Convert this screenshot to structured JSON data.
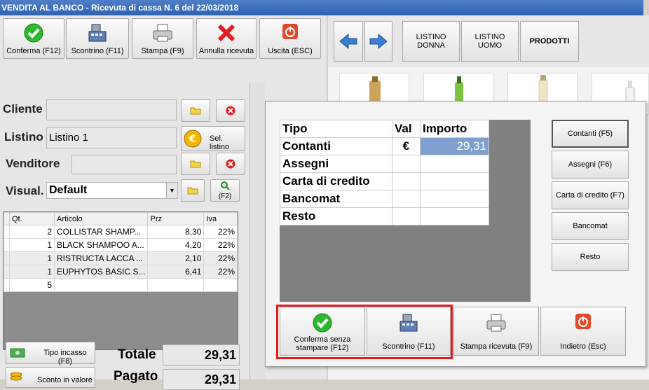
{
  "window": {
    "title": "VENDITA AL BANCO - Ricevuta di cassa N. 6 del 22/03/2018"
  },
  "toolbar": {
    "confirm": "Conferma (F12)",
    "receipt": "Scontrino (F11)",
    "print": "Stampa (F9)",
    "cancel": "Annulla ricevuta",
    "exit": "Uscita (ESC)"
  },
  "nav": {
    "listino_donna": "LISTINO DONNA",
    "listino_uomo": "LISTINO UOMO",
    "prodotti": "PRODOTTI"
  },
  "form": {
    "cliente_label": "Cliente",
    "cliente_value": "",
    "listino_label": "Listino",
    "listino_value": "Listino 1",
    "sel_listino": "Sel. listino",
    "venditore_label": "Venditore",
    "venditore_value": "",
    "visual_label": "Visual.",
    "visual_value": "Default",
    "f2": "(F2)"
  },
  "grid": {
    "headers": {
      "qt": "Qt.",
      "articolo": "Articolo",
      "prz": "Prz",
      "iva": "Iva"
    },
    "rows": [
      {
        "qt": "2",
        "articolo": "COLLISTAR SHAMP...",
        "prz": "8,30",
        "iva": "22%"
      },
      {
        "qt": "1",
        "articolo": "BLACK SHAMPOO A...",
        "prz": "4,20",
        "iva": "22%"
      },
      {
        "qt": "1",
        "articolo": "RISTRUCTA LACCA ...",
        "prz": "2,10",
        "iva": "22%"
      },
      {
        "qt": "1",
        "articolo": "EUPHYTOS BASIC S...",
        "prz": "6,41",
        "iva": "22%"
      },
      {
        "qt": "5",
        "articolo": "",
        "prz": "",
        "iva": ""
      }
    ]
  },
  "bottom": {
    "tipo_incasso": "Tipo incasso (F8)",
    "sconto": "Sconto in valore",
    "totale_label": "Totale",
    "totale_value": "29,31",
    "pagato_label": "Pagato",
    "pagato_value": "29,31"
  },
  "payment": {
    "headers": {
      "tipo": "Tipo",
      "val": "Val",
      "importo": "Importo"
    },
    "rows": [
      {
        "tipo": "Contanti",
        "val": "€",
        "importo": "29,31"
      },
      {
        "tipo": "Assegni",
        "val": "",
        "importo": ""
      },
      {
        "tipo": "Carta di credito",
        "val": "",
        "importo": ""
      },
      {
        "tipo": "Bancomat",
        "val": "",
        "importo": ""
      },
      {
        "tipo": "Resto",
        "val": "",
        "importo": ""
      }
    ],
    "side_buttons": {
      "contanti": "Contanti (F5)",
      "assegni": "Assegni (F6)",
      "carta": "Carta di credito (F7)",
      "bancomat": "Bancomat",
      "resto": "Resto"
    },
    "bottom_buttons": {
      "confirm_no_print": "Conferma senza stampare (F12)",
      "receipt": "Scontrino (F11)",
      "print_receipt": "Stampa ricevuta (F9)",
      "back": "Indietro (Esc)"
    }
  },
  "colors": {
    "highlight": "#7f9fcf",
    "accent_red": "#e51d1d",
    "title_bar": "#2f62b3"
  }
}
